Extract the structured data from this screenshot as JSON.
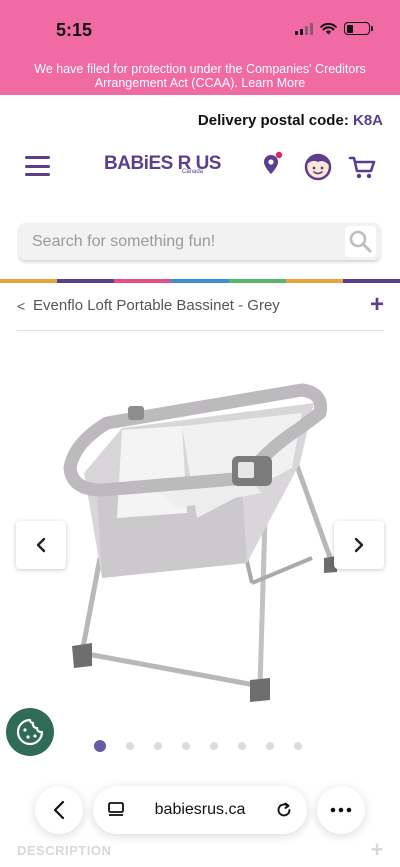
{
  "status_bar": {
    "time": "5:15"
  },
  "banner": {
    "text": "We have filed for protection under the Companies' Creditors Arrangement Act (CCAA).",
    "link": "Learn More"
  },
  "delivery": {
    "label": "Delivery postal code:",
    "code": "K8A"
  },
  "header": {
    "logo_text": "BABiES R US",
    "logo_sub": "Canada",
    "icons": [
      "menu-icon",
      "location-pin-icon",
      "account-icon",
      "cart-icon"
    ]
  },
  "search": {
    "placeholder": "Search for something fun!"
  },
  "breadcrumb": {
    "back": "<",
    "title": "Evenflo Loft Portable Bassinet - Grey",
    "expand": "+"
  },
  "carousel": {
    "slide_count": 8,
    "active_index": 0,
    "prev": "‹",
    "next": "›"
  },
  "description": {
    "label": "DESCRIPTION",
    "expand": "+"
  },
  "browser": {
    "url": "babiesrus.ca"
  },
  "colors": {
    "brand_pink": "#f06aa3",
    "brand_purple": "#5b3f8c",
    "cookie_green": "#2f6b57",
    "dot_active": "#6a5aa6",
    "rainbow": [
      "#e9a33b",
      "#5b3f8c",
      "#e54e86",
      "#3a8fd0",
      "#59b66b",
      "#e9a33b",
      "#5b3f8c"
    ]
  }
}
